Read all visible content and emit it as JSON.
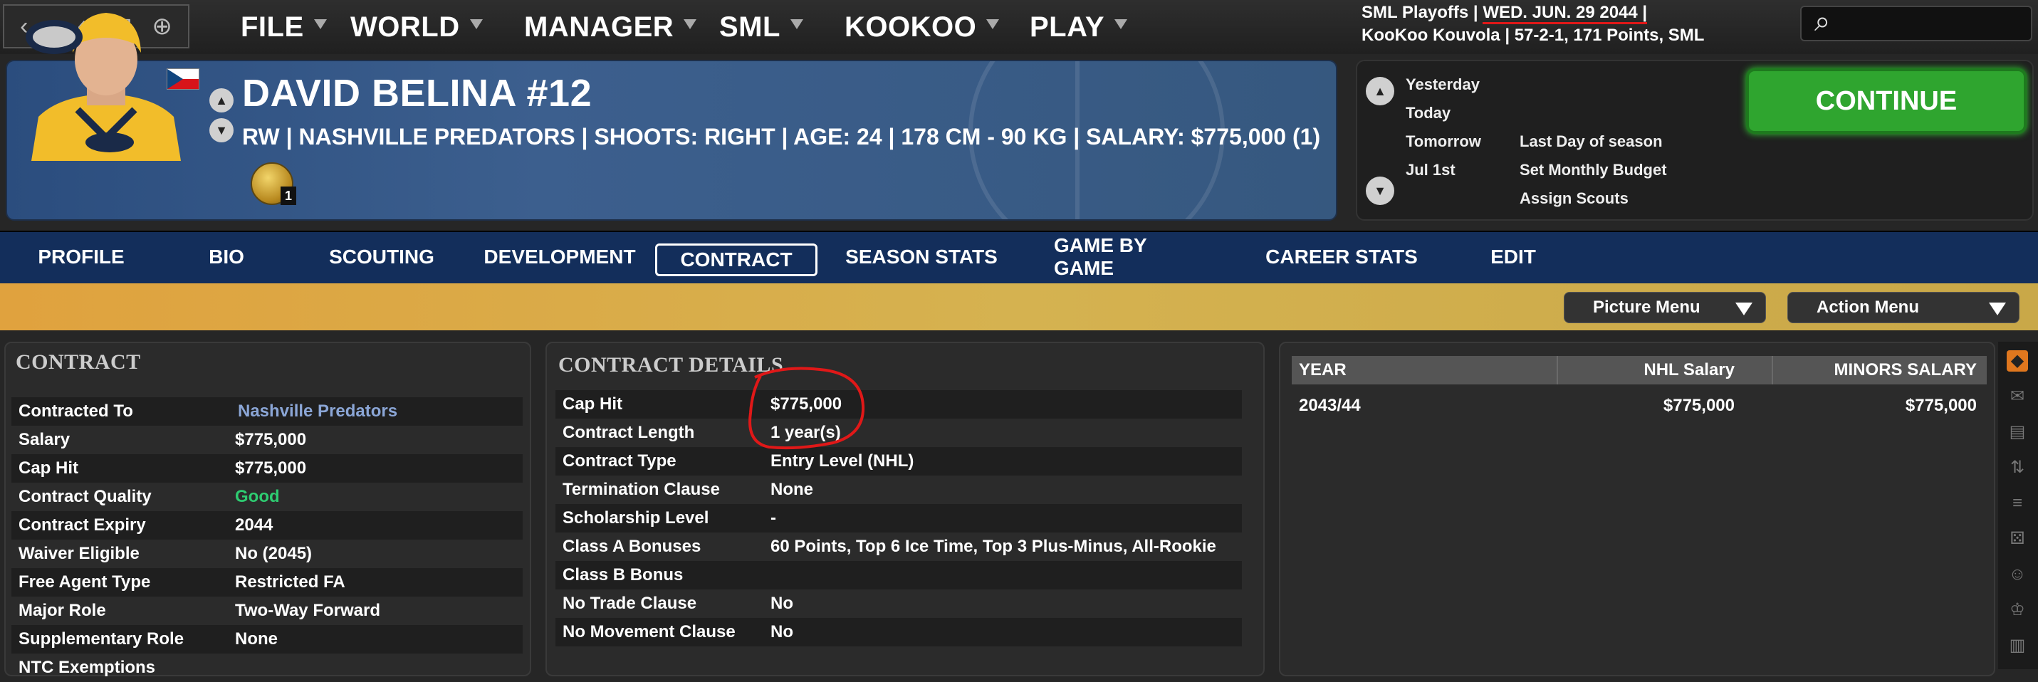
{
  "nav": {
    "back": "‹",
    "forward": "›",
    "home": "⌂",
    "mail": "✉",
    "globe": "⊕"
  },
  "menu": [
    {
      "label": "FILE"
    },
    {
      "label": "WORLD"
    },
    {
      "label": "MANAGER"
    },
    {
      "label": "SML"
    },
    {
      "label": "KOOKOO"
    },
    {
      "label": "PLAY"
    }
  ],
  "header": {
    "line1_a": "SML Playoffs |",
    "date": "WED. JUN. 29 2044 |",
    "line2_team": "KooKoo Kouvola |",
    "line2_record": "57-2-1, 171 Points, SML",
    "search_icon": "⌕"
  },
  "player": {
    "name": "DAVID BELINA #12",
    "info": "RW | NASHVILLE PREDATORS | SHOOTS: RIGHT | AGE: 24 | 178 CM - 90 KG | SALARY: $775,000 (1)",
    "medal_count": "1"
  },
  "calendar": {
    "days": [
      "Yesterday",
      "Today",
      "Tomorrow",
      "Jul 1st"
    ],
    "events": [
      "Last Day of season",
      "Set Monthly Budget",
      "Assign Scouts"
    ],
    "continue": "CONTINUE"
  },
  "tabs": [
    "PROFILE",
    "BIO",
    "SCOUTING",
    "DEVELOPMENT",
    "CONTRACT",
    "SEASON STATS",
    "GAME BY GAME",
    "CAREER STATS",
    "EDIT"
  ],
  "dropdowns": {
    "picture": "Picture Menu",
    "action": "Action Menu"
  },
  "contract": {
    "title": "CONTRACT",
    "rows": [
      {
        "label": "Contracted To",
        "value": "Nashville Predators"
      },
      {
        "label": "Salary",
        "value": "$775,000"
      },
      {
        "label": "Cap Hit",
        "value": "$775,000"
      },
      {
        "label": "Contract Quality",
        "value": "Good"
      },
      {
        "label": "Contract Expiry",
        "value": "2044"
      },
      {
        "label": "Waiver Eligible",
        "value": "No (2045)"
      },
      {
        "label": "Free Agent Type",
        "value": "Restricted FA"
      },
      {
        "label": "Major Role",
        "value": "Two-Way Forward"
      },
      {
        "label": "Supplementary Role",
        "value": "None"
      },
      {
        "label": "NTC Exemptions",
        "value": ""
      }
    ]
  },
  "details": {
    "title": "CONTRACT DETAILS",
    "rows": [
      {
        "label": "Cap Hit",
        "value": "$775,000"
      },
      {
        "label": "Contract Length",
        "value": "1 year(s)"
      },
      {
        "label": "Contract Type",
        "value": "Entry Level (NHL)"
      },
      {
        "label": "Termination Clause",
        "value": "None"
      },
      {
        "label": "Scholarship Level",
        "value": "-"
      },
      {
        "label": "Class A Bonuses",
        "value": "60 Points, Top 6 Ice Time, Top 3 Plus-Minus, All-Rookie"
      },
      {
        "label": "Class B Bonus",
        "value": ""
      },
      {
        "label": "No Trade Clause",
        "value": "No"
      },
      {
        "label": "No Movement Clause",
        "value": "No"
      }
    ]
  },
  "salary_table": {
    "headers": [
      "YEAR",
      "NHL Salary",
      "MINORS SALARY"
    ],
    "rows": [
      [
        "2043/44",
        "$775,000",
        "$775,000"
      ]
    ]
  },
  "colors": {
    "accent_gold": "#d8aa48",
    "tab_blue": "#132e5b",
    "continue_green": "#2fa52f",
    "good": "#2ecc71",
    "annotation_red": "#e01818"
  }
}
